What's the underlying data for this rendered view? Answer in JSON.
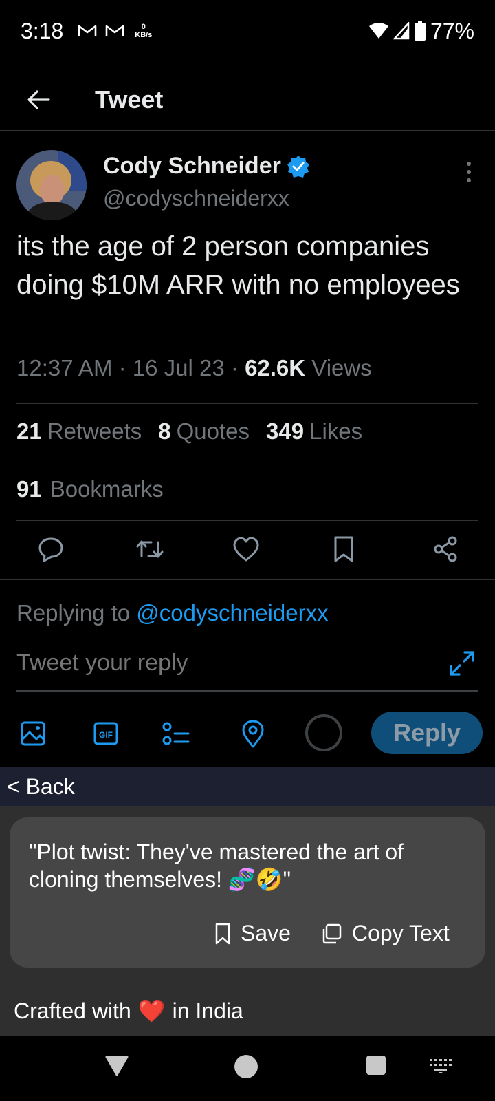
{
  "status_bar": {
    "time": "3:18",
    "net_speed_value": "0",
    "net_speed_unit": "KB/s",
    "battery": "77%",
    "icons": [
      "gmail-icon",
      "gmail-icon",
      "wifi-icon",
      "signal-icon",
      "battery-icon"
    ]
  },
  "header": {
    "title": "Tweet",
    "back_icon": "back-arrow-icon"
  },
  "tweet": {
    "author_name": "Cody Schneider",
    "author_handle": "@codyschneiderxx",
    "verified": true,
    "text": "its the age of 2 person companies doing $10M ARR with no employees",
    "time": "12:37 AM",
    "date": "16 Jul 23",
    "views_count": "62.6K",
    "views_label": "Views",
    "separator": "·"
  },
  "stats": {
    "retweets_count": "21",
    "retweets_label": "Retweets",
    "quotes_count": "8",
    "quotes_label": "Quotes",
    "likes_count": "349",
    "likes_label": "Likes",
    "bookmarks_count": "91",
    "bookmarks_label": "Bookmarks"
  },
  "actions": [
    "reply-icon",
    "retweet-icon",
    "like-icon",
    "bookmark-icon",
    "share-icon"
  ],
  "reply_box": {
    "replying_prefix": "Replying to",
    "replying_handle": "@codyschneiderxx",
    "placeholder": "Tweet your reply",
    "reply_button": "Reply"
  },
  "compose_tools": [
    "image-icon",
    "gif-icon",
    "poll-icon",
    "location-icon"
  ],
  "keyboard_panel": {
    "back_label": "< Back",
    "suggestion_text": "\"Plot twist: They've mastered the art of cloning themselves! 🧬🤣\"",
    "save_label": "Save",
    "copy_label": "Copy Text",
    "crafted_prefix": "Crafted with",
    "crafted_heart": "❤️",
    "crafted_suffix": "in India"
  },
  "colors": {
    "accent": "#1d9bf0",
    "background": "#000000",
    "muted_text": "#71767b",
    "divider": "#2f3336",
    "reply_button_bg": "#0f4e78",
    "panel_bg": "#2f2f2f",
    "card_bg": "#464646"
  }
}
